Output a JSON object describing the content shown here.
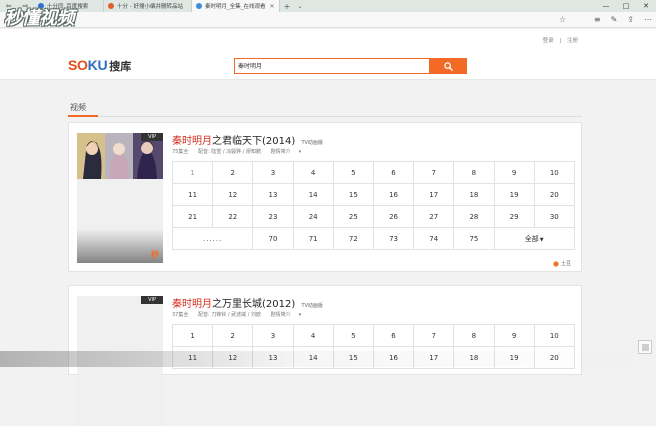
{
  "browser": {
    "tabs": [
      {
        "label": "十分同_百度搜索",
        "active": false,
        "color": "#2f6fd6"
      },
      {
        "label": "十分 - 好搜小编并删转品站",
        "active": false,
        "color": "#e05c2a"
      },
      {
        "label": "秦时明月_全集_在线观看",
        "active": true,
        "color": "#3b8fd8"
      }
    ],
    "nav_back": "⇦",
    "nav_forward": "⇨",
    "new_tab": "+",
    "tab_menu": "⌄",
    "minimize": "—",
    "maximize": "□",
    "close": "✕",
    "tab_close": "✕",
    "star": "☆",
    "watermark": "秒懂视频"
  },
  "header": {
    "links": [
      "登录",
      "注册"
    ],
    "logo_latin_a": "SO",
    "logo_latin_b": "KU",
    "logo_cn": "搜库",
    "search_value": "秦时明月",
    "accent": "#f26a26"
  },
  "section": {
    "tab": "视频"
  },
  "results": [
    {
      "title_highlight": "秦时明月",
      "title_rest": "之君临天下(2014)",
      "tag": "TV动画版",
      "vip": "VIP",
      "meta_count": "75集全",
      "meta_cast": "配音: 陆雪 / 冯骏骅 / 廖知鹏",
      "meta_detail": "剧情简介",
      "episodes_row1": [
        "1",
        "2",
        "3",
        "4",
        "5",
        "6",
        "7",
        "8",
        "9",
        "10"
      ],
      "episodes_row2": [
        "11",
        "12",
        "13",
        "14",
        "15",
        "16",
        "17",
        "18",
        "19",
        "20"
      ],
      "episodes_row3": [
        "21",
        "22",
        "23",
        "24",
        "25",
        "26",
        "27",
        "28",
        "29",
        "30"
      ],
      "episodes_row4_dots": "......",
      "episodes_row4": [
        "70",
        "71",
        "72",
        "73",
        "74",
        "75"
      ],
      "all_label": "全部",
      "source": "土豆",
      "play_mark": "秒"
    },
    {
      "title_highlight": "秦时明月",
      "title_rest": "之万里长城(2012)",
      "tag": "TV动画版",
      "vip": "VIP",
      "meta_count": "37集全",
      "meta_cast": "配音: 刀锋铃 / 武述威 / 刘欧",
      "meta_detail": "剧情简介",
      "episodes_row1": [
        "1",
        "2",
        "3",
        "4",
        "5",
        "6",
        "7",
        "8",
        "9",
        "10"
      ],
      "episodes_row2": [
        "11",
        "12",
        "13",
        "14",
        "15",
        "16",
        "17",
        "18",
        "19",
        "20"
      ]
    }
  ]
}
